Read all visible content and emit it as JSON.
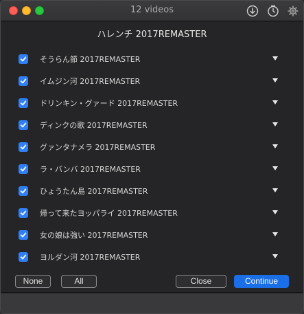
{
  "window": {
    "title": "12 videos"
  },
  "sheet": {
    "album_title": "ハレンチ 2017REMASTER",
    "tracks": [
      {
        "label": "そうらん節 2017REMASTER",
        "checked": true
      },
      {
        "label": "イムジン河 2017REMASTER",
        "checked": true
      },
      {
        "label": "ドリンキン・グァード 2017REMASTER",
        "checked": true
      },
      {
        "label": "ディンクの歌 2017REMASTER",
        "checked": true
      },
      {
        "label": "グァンタナメラ 2017REMASTER",
        "checked": true
      },
      {
        "label": "ラ・バンバ 2017REMASTER",
        "checked": true
      },
      {
        "label": "ひょうたん島 2017REMASTER",
        "checked": true
      },
      {
        "label": "帰って来たヨッパライ 2017REMASTER",
        "checked": true
      },
      {
        "label": "女の娘は強い 2017REMASTER",
        "checked": true
      },
      {
        "label": "ヨルダン河 2017REMASTER",
        "checked": true
      }
    ]
  },
  "buttons": {
    "none_label": "None",
    "all_label": "All",
    "close_label": "Close",
    "continue_label": "Continue"
  },
  "icons": {
    "download": "download-icon",
    "clock": "clock-icon",
    "settings": "gear-icon"
  },
  "colors": {
    "accent": "#1a6fe6",
    "checkbox": "#2f7ff5"
  }
}
